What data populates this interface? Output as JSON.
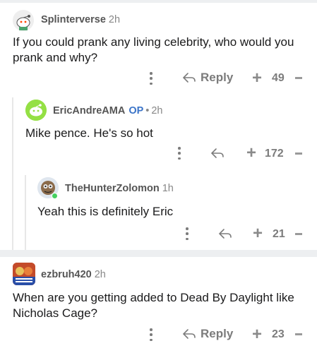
{
  "comments": [
    {
      "username": "Splinterverse",
      "time": "2h",
      "body_line1": "If you could prank any living celebrity, who would you",
      "body_line2": "prank and why?",
      "reply_label": "Reply",
      "votes": "49"
    },
    {
      "username": "EricAndreAMA",
      "op_badge": "OP",
      "dot": "•",
      "time": "2h",
      "body_line1": "Mike pence. He's so hot",
      "votes": "172"
    },
    {
      "username": "TheHunterZolomon",
      "time": "1h",
      "body_line1": "Yeah this is definitely Eric",
      "votes": "21"
    },
    {
      "username": "ezbruh420",
      "time": "2h",
      "body_line1": "When are you getting added to Dead By Daylight like",
      "body_line2": "Nicholas Cage?",
      "reply_label": "Reply",
      "votes": "23"
    }
  ],
  "colors": {
    "separator": "#edeff1",
    "op_badge": "#3b74c8",
    "online": "#46d160"
  }
}
